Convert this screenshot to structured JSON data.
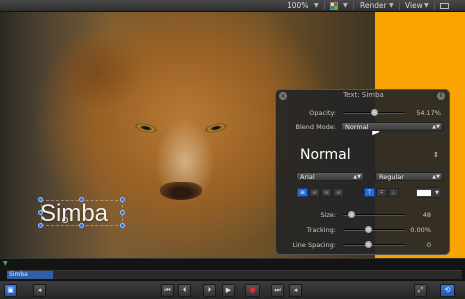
{
  "toolbar": {
    "zoom": "100%",
    "render": "Render",
    "view": "View"
  },
  "canvas": {
    "title_text": "Simba"
  },
  "hud": {
    "title": "Text: Simba",
    "opacity_label": "Opacity:",
    "opacity_value": "54.17%",
    "opacity_level": 0.5417,
    "blend_label": "Blend Mode:",
    "blend_value": "Normal",
    "preset": "Normal",
    "font_family": "Arial",
    "font_style": "Regular",
    "size_label": "Size:",
    "size_value": "48",
    "tracking_label": "Tracking:",
    "tracking_value": "0.00%",
    "spacing_label": "Line Spacing:",
    "spacing_value": "0",
    "text_color": "#ffffff"
  },
  "timeline": {
    "clip_name": "Simba",
    "clip_color": "#2e5fa8"
  },
  "colors": {
    "accent": "#2b6ad6",
    "background_fill": "#f9a400",
    "record": "#e03030"
  },
  "icons": [
    "close-icon",
    "info-icon",
    "align-left-icon",
    "align-center-icon",
    "align-right-icon",
    "justify-icon",
    "color-swatch-icon",
    "play-icon",
    "record-icon",
    "loop-icon",
    "fullscreen-icon"
  ]
}
